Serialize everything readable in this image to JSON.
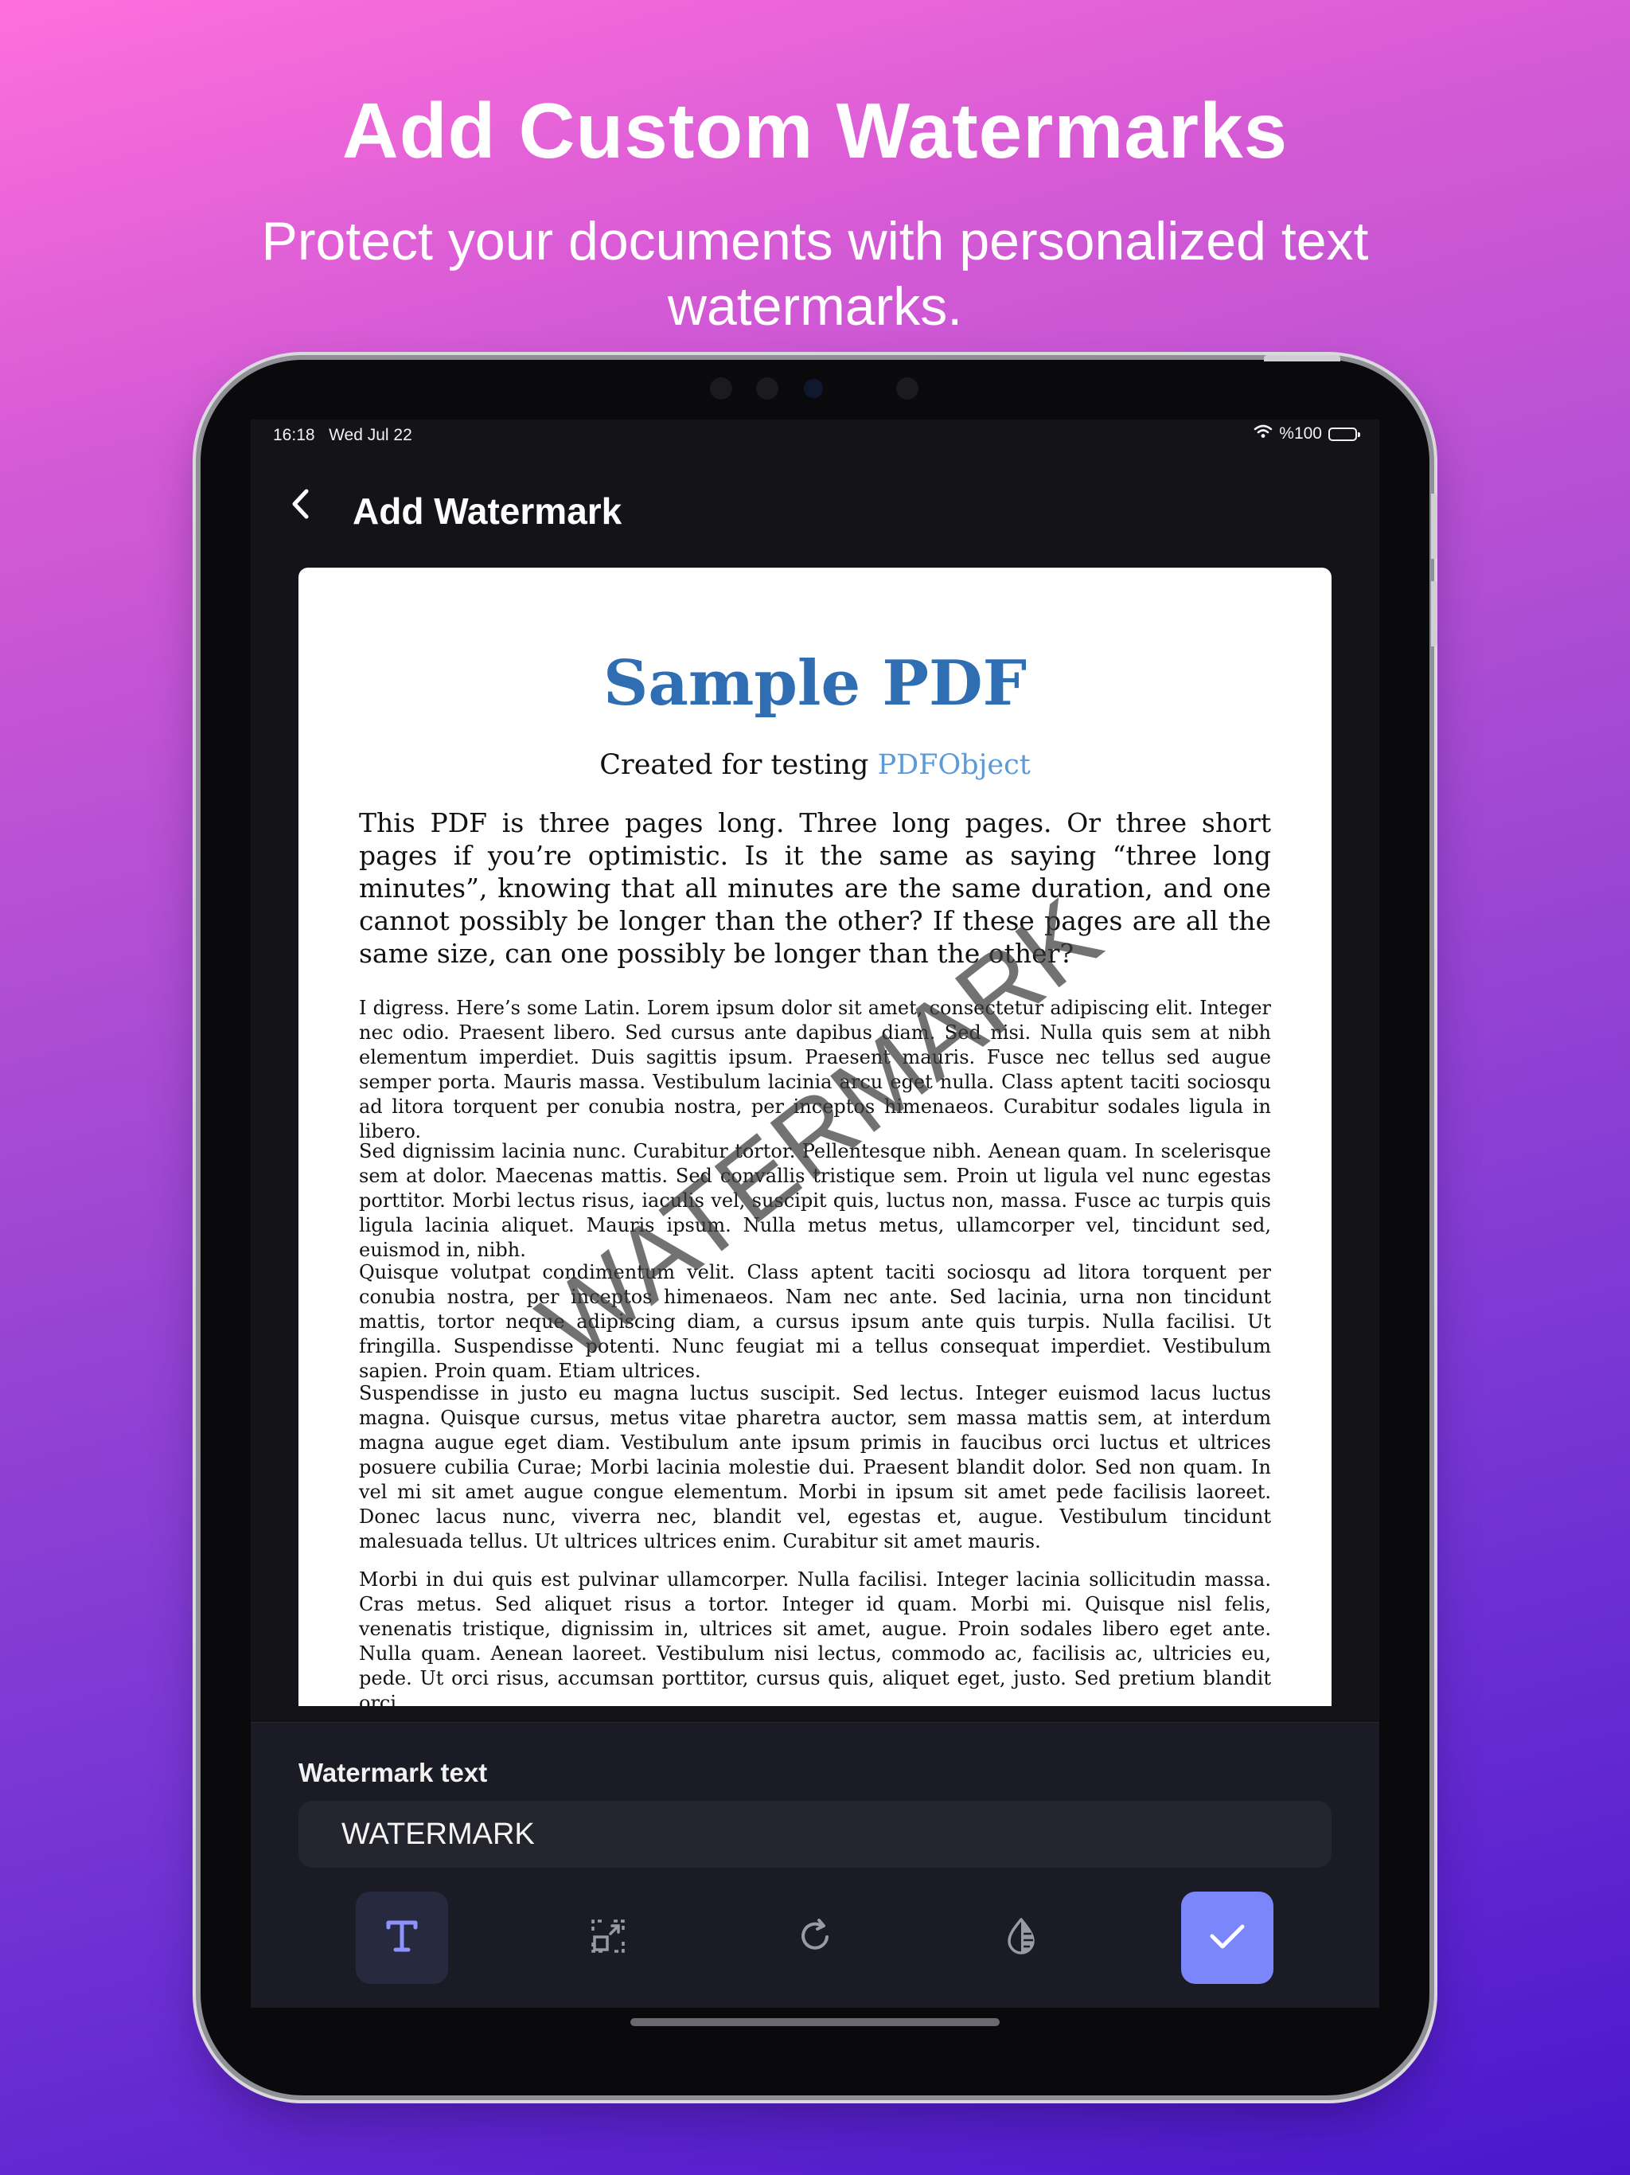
{
  "promo": {
    "headline": "Add Custom Watermarks",
    "subhead": "Protect your documents with personalized text watermarks."
  },
  "status_bar": {
    "time": "16:18",
    "date": "Wed Jul 22",
    "battery_text": "%100",
    "battery_level": 1.0
  },
  "nav": {
    "title": "Add Watermark"
  },
  "pdf": {
    "title": "Sample PDF",
    "subtitle_prefix": "Created for testing ",
    "subtitle_link": "PDFObject",
    "intro": "This PDF is three pages long. Three long pages. Or three short pages if you’re optimistic. Is it the same as saying “three long minutes”, knowing that all minutes are the same duration, and one cannot possibly be longer than the other? If these pages are all the same size, can one possibly be longer than the other?",
    "paragraphs": [
      "I digress. Here’s some Latin. Lorem ipsum dolor sit amet, consectetur adipiscing elit. Integer nec odio. Praesent libero. Sed cursus ante dapibus diam. Sed nisi. Nulla quis sem at nibh elementum imperdiet. Duis sagittis ipsum. Praesent mauris. Fusce nec tellus sed augue semper porta. Mauris massa. Vestibulum lacinia arcu eget nulla. Class aptent taciti sociosqu ad litora torquent per conubia nostra, per inceptos himenaeos. Curabitur sodales ligula in libero.",
      "Sed dignissim lacinia nunc. Curabitur tortor. Pellentesque nibh. Aenean quam. In scelerisque sem at dolor. Maecenas mattis. Sed convallis tristique sem. Proin ut ligula vel nunc egestas porttitor. Morbi lectus risus, iaculis vel, suscipit quis, luctus non, massa. Fusce ac turpis quis ligula lacinia aliquet. Mauris ipsum. Nulla metus metus, ullamcorper vel, tincidunt sed, euismod in, nibh.",
      "Quisque volutpat condimentum velit. Class aptent taciti sociosqu ad litora torquent per conubia nostra, per inceptos himenaeos. Nam nec ante. Sed lacinia, urna non tincidunt mattis, tortor neque adipiscing diam, a cursus ipsum ante quis turpis. Nulla facilisi. Ut fringilla. Suspendisse potenti. Nunc feugiat mi a tellus consequat imperdiet. Vestibulum sapien. Proin quam. Etiam ultrices.",
      "Suspendisse in justo eu magna luctus suscipit. Sed lectus. Integer euismod lacus luctus magna. Quisque cursus, metus vitae pharetra auctor, sem massa mattis sem, at interdum magna augue eget diam. Vestibulum ante ipsum primis in faucibus orci luctus et ultrices posuere cubilia Curae; Morbi lacinia molestie dui. Praesent blandit dolor. Sed non quam. In vel mi sit amet augue congue elementum. Morbi in ipsum sit amet pede facilisis laoreet. Donec lacus nunc, viverra nec, blandit vel, egestas et, augue. Vestibulum tincidunt malesuada tellus. Ut ultrices ultrices enim. Curabitur sit amet mauris.",
      "Morbi in dui quis est pulvinar ullamcorper. Nulla facilisi. Integer lacinia sollicitudin massa. Cras metus. Sed aliquet risus a tortor. Integer id quam. Morbi mi. Quisque nisl felis, venenatis tristique, dignissim in, ultrices sit amet, augue. Proin sodales libero eget ante. Nulla quam. Aenean laoreet. Vestibulum nisi lectus, commodo ac, facilisis ac, ultricies eu, pede. Ut orci risus, accumsan porttitor, cursus quis, aliquet eget, justo. Sed pretium blandit orci."
    ],
    "watermark_overlay": "WATERMARK"
  },
  "panel": {
    "label": "Watermark text",
    "input_value": "WATERMARK"
  },
  "toolbar": {
    "tools": [
      {
        "name": "text-tool",
        "icon": "text-icon",
        "active": true
      },
      {
        "name": "resize-tool",
        "icon": "resize-icon",
        "active": false
      },
      {
        "name": "rotate-tool",
        "icon": "rotate-icon",
        "active": false
      },
      {
        "name": "opacity-tool",
        "icon": "opacity-icon",
        "active": false
      },
      {
        "name": "confirm-tool",
        "icon": "checkmark-icon",
        "active": false
      }
    ]
  },
  "colors": {
    "accent": "#7c86fb",
    "pdf_title": "#2f6eb2",
    "pdf_link": "#5b9ad8",
    "background_top": "#fe6fdc",
    "background_bottom": "#4b17cc"
  }
}
